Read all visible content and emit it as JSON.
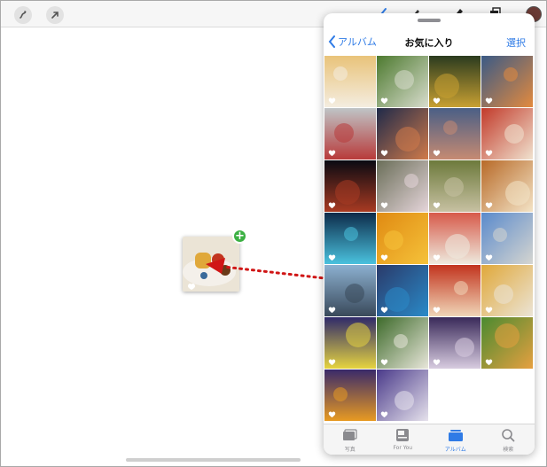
{
  "toolbar": {
    "left_tools": [
      {
        "icon": "squiggle-pen-icon"
      },
      {
        "icon": "arrow-select-icon"
      }
    ],
    "right_tools": [
      {
        "icon": "pen-icon"
      },
      {
        "icon": "pencil-icon"
      },
      {
        "icon": "marker-icon"
      },
      {
        "icon": "layers-icon"
      }
    ],
    "current_color": "#6b3a35"
  },
  "photos_panel": {
    "back_label": "アルバム",
    "title": "お気に入り",
    "select_label": "選択",
    "favorite_marker": "heart-icon",
    "photos": [
      {
        "subject": "dessert plate",
        "c1": "#e9c37a",
        "c2": "#f4ede0"
      },
      {
        "subject": "salad plate",
        "c1": "#4d7a2f",
        "c2": "#d8dccd"
      },
      {
        "subject": "new year decoration",
        "c1": "#2b3b1f",
        "c2": "#c8a032"
      },
      {
        "subject": "sunset sea",
        "c1": "#3a5a86",
        "c2": "#e38a3e"
      },
      {
        "subject": "hand with drink",
        "c1": "#bfc4c6",
        "c2": "#b83a3a"
      },
      {
        "subject": "twilight skyline",
        "c1": "#1f2a4a",
        "c2": "#d07a4a"
      },
      {
        "subject": "evening clouds",
        "c1": "#4a5f86",
        "c2": "#c68a72"
      },
      {
        "subject": "strawberry cake",
        "c1": "#c23a2a",
        "c2": "#f0e2cf"
      },
      {
        "subject": "lunar eclipse",
        "c1": "#0a0a12",
        "c2": "#a83a22"
      },
      {
        "subject": "cherry blossoms",
        "c1": "#6a6e58",
        "c2": "#e5d5da"
      },
      {
        "subject": "park path",
        "c1": "#6d7a3c",
        "c2": "#c7c1a2"
      },
      {
        "subject": "spiral bread",
        "c1": "#b86a28",
        "c2": "#f3e3c6"
      },
      {
        "subject": "illuminated trees",
        "c1": "#0d2b4a",
        "c2": "#4ac2de"
      },
      {
        "subject": "sunflower",
        "c1": "#e08a12",
        "c2": "#f5c23a"
      },
      {
        "subject": "sushi plate",
        "c1": "#d75a4a",
        "c2": "#eeeade"
      },
      {
        "subject": "building under sky",
        "c1": "#5a8acc",
        "c2": "#d5d5d0"
      },
      {
        "subject": "airport view",
        "c1": "#8cb0d0",
        "c2": "#39495a"
      },
      {
        "subject": "blue train",
        "c1": "#2a3a6a",
        "c2": "#2a8ac8"
      },
      {
        "subject": "sushi closeup",
        "c1": "#c2341e",
        "c2": "#f0d6b8"
      },
      {
        "subject": "pudding dessert",
        "c1": "#e0a83a",
        "c2": "#ebe4d6"
      },
      {
        "subject": "pansies purple",
        "c1": "#2f2a6a",
        "c2": "#e6d440"
      },
      {
        "subject": "white pansies",
        "c1": "#3d6a2a",
        "c2": "#e8e6da"
      },
      {
        "subject": "violet flowers",
        "c1": "#3a2a5a",
        "c2": "#d8cce0"
      },
      {
        "subject": "salad bowl",
        "c1": "#4a8a30",
        "c2": "#e6a040"
      },
      {
        "subject": "orange pansies",
        "c1": "#3a2a6a",
        "c2": "#e89a22"
      },
      {
        "subject": "pansy mix",
        "c1": "#4a3a8a",
        "c2": "#e6e2ec"
      }
    ]
  },
  "tabbar": {
    "tabs": [
      {
        "label": "写真",
        "icon": "photos-tab-icon"
      },
      {
        "label": "For You",
        "icon": "for-you-tab-icon"
      },
      {
        "label": "アルバム",
        "icon": "albums-tab-icon"
      },
      {
        "label": "検索",
        "icon": "search-icon"
      }
    ],
    "active_index": 2,
    "accent_color": "#2f7be6"
  },
  "drag": {
    "badge_symbol": "+",
    "arrow_color": "#d01616"
  }
}
